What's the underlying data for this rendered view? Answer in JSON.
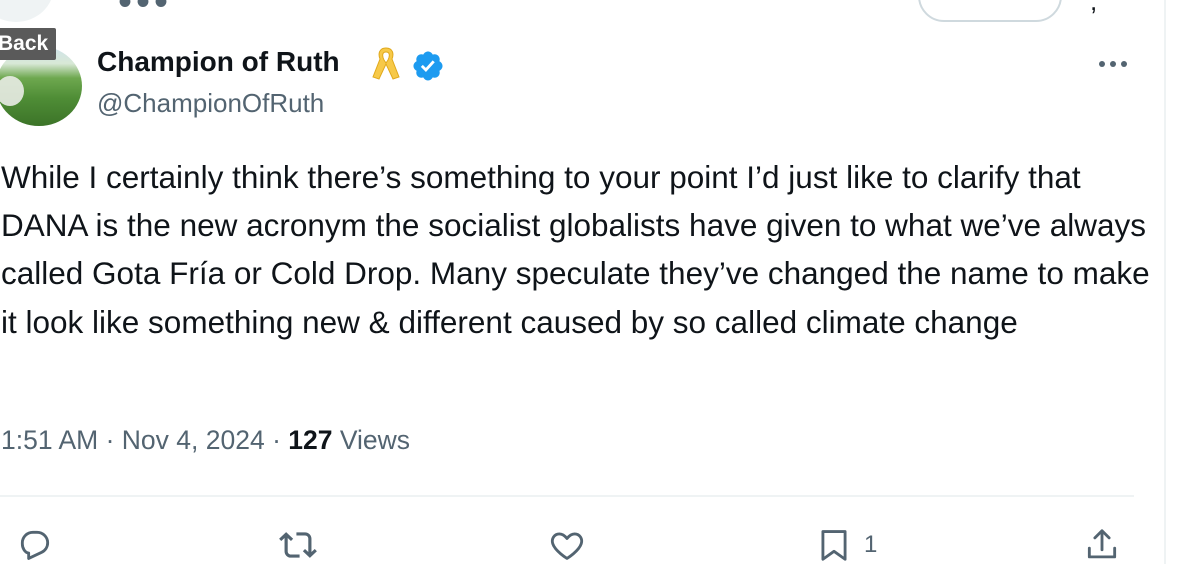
{
  "header": {
    "back_label": "Back"
  },
  "author": {
    "display_name": "Champion of Ruth",
    "handle": "@ChampionOfRuth",
    "verified": true,
    "badge_emoji": "yellow-ribbon"
  },
  "tweet": {
    "text": "While I certainly think there’s something to your point I’d just like to clarify that DANA is the new acronym the socialist globalists have given to what we’ve always called Gota Fría or Cold Drop. Many speculate they’ve changed the name to make it look like something new & different caused by so called climate change",
    "time": "1:51 AM",
    "separator": " · ",
    "date": "Nov 4, 2024",
    "views_count": "127",
    "views_label": " Views"
  },
  "actions": {
    "reply_icon": "reply-icon",
    "retweet_icon": "retweet-icon",
    "like_icon": "heart-icon",
    "bookmark_icon": "bookmark-icon",
    "bookmark_count": "1",
    "share_icon": "share-icon"
  },
  "colors": {
    "text_primary": "#0f1419",
    "text_secondary": "#536471",
    "verified_blue": "#1d9bf0",
    "ribbon_yellow": "#f7c948",
    "divider": "#eff3f4"
  }
}
